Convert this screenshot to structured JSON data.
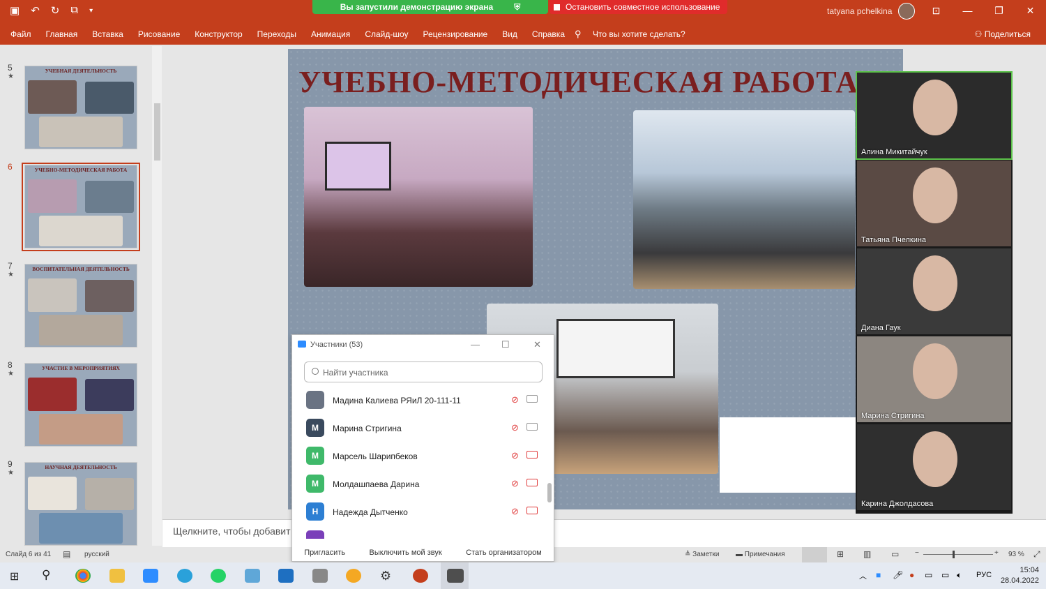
{
  "window": {
    "user_name": "tatyana pchelkina",
    "share_banner": "Вы запустили демонстрацию экрана",
    "stop_sharing": "Остановить совместное использование"
  },
  "ribbon": {
    "tabs": [
      "Файл",
      "Главная",
      "Вставка",
      "Рисование",
      "Конструктор",
      "Переходы",
      "Анимация",
      "Слайд-шоу",
      "Рецензирование",
      "Вид",
      "Справка"
    ],
    "tell_me": "Что вы хотите сделать?",
    "share": "Поделиться"
  },
  "thumbnails": [
    {
      "num": "5",
      "title": "УЧЕБНАЯ ДЕЯТЕЛЬНОСТЬ",
      "selected": false
    },
    {
      "num": "6",
      "title": "УЧЕБНО-МЕТОДИЧЕСКАЯ РАБОТА",
      "selected": true
    },
    {
      "num": "7",
      "title": "ВОСПИТАТЕЛЬНАЯ ДЕЯТЕЛЬНОСТЬ",
      "selected": false
    },
    {
      "num": "8",
      "title": "УЧАСТИЕ В МЕРОПРИЯТИЯХ",
      "selected": false
    },
    {
      "num": "9",
      "title": "НАУЧНАЯ ДЕЯТЕЛЬНОСТЬ",
      "selected": false
    }
  ],
  "slide": {
    "title": "УЧЕБНО-МЕТОДИЧЕСКАЯ РАБОТА"
  },
  "notes_placeholder": "Щелкните, чтобы добавит",
  "participants": {
    "title": "Участники (53)",
    "search_placeholder": "Найти участника",
    "rows": [
      {
        "initial": "",
        "name": "Мадина Калиева РЯиЛ 20-111-11",
        "color": "#6a7383",
        "cam_off": false
      },
      {
        "initial": "М",
        "name": "Марина Стригина",
        "color": "#3a4a5e",
        "cam_off": false
      },
      {
        "initial": "М",
        "name": "Марсель Шарипбеков",
        "color": "#3fb96a",
        "cam_off": true
      },
      {
        "initial": "М",
        "name": "Молдашпаева Дарина",
        "color": "#3fb96a",
        "cam_off": true
      },
      {
        "initial": "Н",
        "name": "Надежда Дытченко",
        "color": "#2d7fd3",
        "cam_off": true
      }
    ],
    "footer": [
      "Пригласить",
      "Выключить мой звук",
      "Стать организатором"
    ]
  },
  "gallery": [
    {
      "name": "Алина Микитайчук",
      "bg": "#2b2b2b"
    },
    {
      "name": "Татьяна Пчелкина",
      "bg": "#5a4a44"
    },
    {
      "name": "Диана Гаук",
      "bg": "#3a3a3a"
    },
    {
      "name": "Марина Стригина",
      "bg": "#8c8680"
    },
    {
      "name": "Карина Джолдасова",
      "bg": "#2f2f2f"
    }
  ],
  "status": {
    "slide_of": "Слайд 6 из 41",
    "language": "русский",
    "notes": "Заметки",
    "comments": "Примечания",
    "zoom": "93 %"
  },
  "tray": {
    "lang": "РУС",
    "time": "15:04",
    "date": "28.04.2022"
  },
  "colors": {
    "accent": "#c43e1c",
    "share_green": "#39b54a",
    "stop_red": "#e02b2b"
  }
}
